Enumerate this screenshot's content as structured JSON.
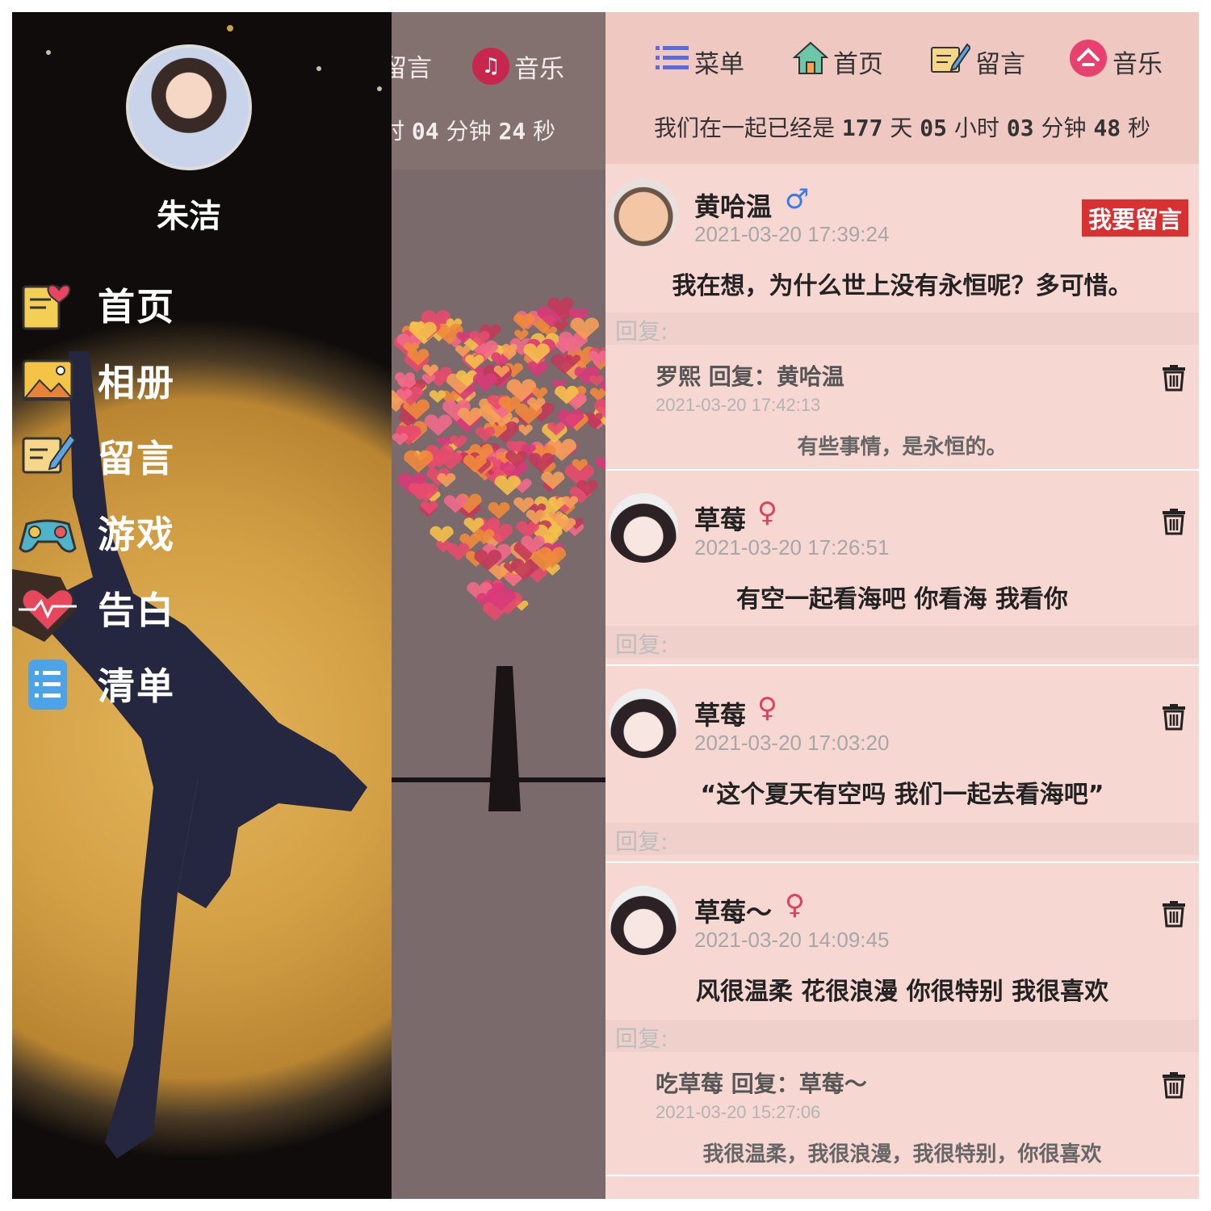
{
  "left_screen": {
    "behind": {
      "nav_fragment": "留言",
      "music_icon": "music-note-icon",
      "music_label": "音乐",
      "counter_prefix": "时",
      "minutes": "04",
      "minutes_unit": "分钟",
      "seconds": "24",
      "seconds_unit": "秒"
    },
    "drawer": {
      "username": "朱洁",
      "items": [
        {
          "label": "首页",
          "icon": "notebook-heart-icon"
        },
        {
          "label": "相册",
          "icon": "photo-album-icon"
        },
        {
          "label": "留言",
          "icon": "note-edit-icon"
        },
        {
          "label": "游戏",
          "icon": "gamepad-icon"
        },
        {
          "label": "告白",
          "icon": "heartbeat-icon"
        },
        {
          "label": "清单",
          "icon": "checklist-icon"
        }
      ]
    }
  },
  "right_screen": {
    "nav": [
      {
        "label": "菜单",
        "icon": "menu-list-icon"
      },
      {
        "label": "首页",
        "icon": "home-icon"
      },
      {
        "label": "留言",
        "icon": "note-edit-icon"
      },
      {
        "label": "音乐",
        "icon": "music-disc-icon"
      }
    ],
    "together": {
      "prefix": "我们在一起已经是",
      "days": "177",
      "days_unit": "天",
      "hours": "05",
      "hours_unit": "小时",
      "minutes": "03",
      "minutes_unit": "分钟",
      "seconds": "48",
      "seconds_unit": "秒"
    },
    "leave_message_button": "我要留言",
    "reply_label": "回复:",
    "posts": [
      {
        "name": "黄哈温",
        "gender_symbol": "♂",
        "time": "2021-03-20 17:39:24",
        "content": "我在想，为什么世上没有永恒呢？多可惜。",
        "reply": {
          "author_line": "罗熙 回复：黄哈温",
          "time": "2021-03-20 17:42:13",
          "text": "有些事情，是永恒的。"
        }
      },
      {
        "name": "草莓",
        "gender_symbol": "♀",
        "time": "2021-03-20 17:26:51",
        "content": "有空一起看海吧 你看海 我看你"
      },
      {
        "name": "草莓",
        "gender_symbol": "♀",
        "time": "2021-03-20 17:03:20",
        "content": "“这个夏天有空吗 我们一起去看海吧”"
      },
      {
        "name": "草莓～",
        "gender_symbol": "♀",
        "time": "2021-03-20 14:09:45",
        "content": "风很温柔 花很浪漫 你很特别 我很喜欢",
        "reply": {
          "author_line": "吃草莓 回复：草莓～",
          "time": "2021-03-20 15:27:06",
          "text": "我很温柔，我很浪漫，我很特别，你很喜欢"
        }
      }
    ],
    "colors": {
      "background": "#f6d7d2",
      "top_bar": "#f0c8c2",
      "male": "#3b7be8",
      "female": "#e0405a",
      "button": "#d93131"
    }
  }
}
